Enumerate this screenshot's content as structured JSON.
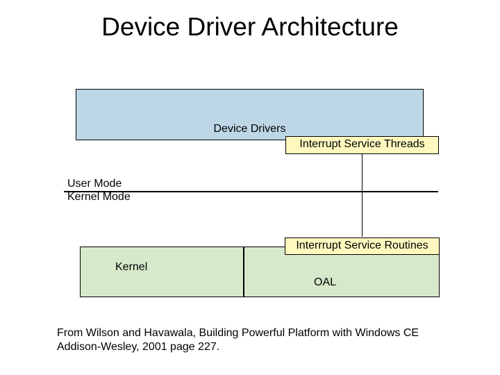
{
  "title": "Device Driver Architecture",
  "boxes": {
    "device_drivers": "Device Drivers",
    "interrupt_service_threads": "Interrupt Service Threads",
    "kernel": "Kernel",
    "interrupt_service_routines": "Interrrupt Service Routines",
    "oal": "OAL"
  },
  "mode_labels": {
    "user": "User Mode",
    "kernel": "Kernel Mode"
  },
  "caption_line1": "From Wilson and Havawala, Building Powerful Platform with Windows CE",
  "caption_line2": "Addison-Wesley, 2001 page 227."
}
